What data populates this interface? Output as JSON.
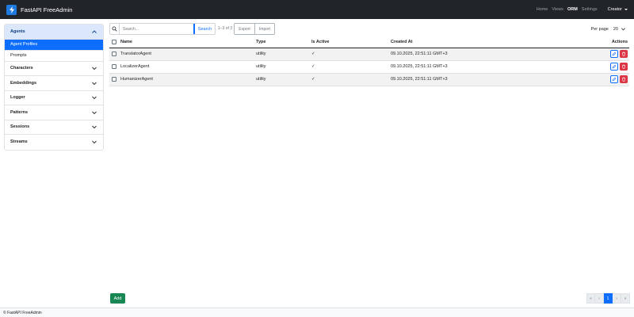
{
  "navbar": {
    "brand": "FastAPI FreeAdmin",
    "links": [
      "Home",
      "Views",
      "ORM",
      "Settings"
    ],
    "active_link": "ORM",
    "user": "Creator"
  },
  "sidebar": {
    "sections": [
      {
        "label": "Agents",
        "open": true,
        "items": [
          {
            "label": "Agent Profiles",
            "active": true
          },
          {
            "label": "Prompts",
            "active": false
          }
        ]
      },
      {
        "label": "Characters",
        "open": false
      },
      {
        "label": "Embeddings",
        "open": false
      },
      {
        "label": "Logger",
        "open": false
      },
      {
        "label": "Patterns",
        "open": false
      },
      {
        "label": "Sessions",
        "open": false
      },
      {
        "label": "Streams",
        "open": false
      }
    ]
  },
  "toolbar": {
    "search_placeholder": "Search...",
    "search_button": "Search",
    "count": "1–3 of 3",
    "export": "Export",
    "import": "Import",
    "per_page_label": "Per page",
    "per_page_value": "20"
  },
  "table": {
    "columns": [
      "Name",
      "Type",
      "Is Active",
      "Created At",
      "Actions"
    ],
    "rows": [
      {
        "name": "TranslatorAgent",
        "type": "utility",
        "is_active": "✓",
        "created_at": "09.10.2025, 22:51:11 GMT+3"
      },
      {
        "name": "LocalizerAgent",
        "type": "utility",
        "is_active": "✓",
        "created_at": "09.10.2025, 22:51:11 GMT+3"
      },
      {
        "name": "HumanizerAgent",
        "type": "utility",
        "is_active": "✓",
        "created_at": "09.10.2025, 22:51:11 GMT+3"
      }
    ]
  },
  "add_button": "Add",
  "pagination": {
    "first": "«",
    "prev": "‹",
    "current": "1",
    "next": "›",
    "last": "»"
  },
  "footer": "© FastAPI FreeAdmin",
  "colors": {
    "navbar_bg": "#212529",
    "primary": "#0d6efd",
    "danger": "#dc3545",
    "success": "#198754",
    "open_section_bg": "#dbe8fb"
  }
}
